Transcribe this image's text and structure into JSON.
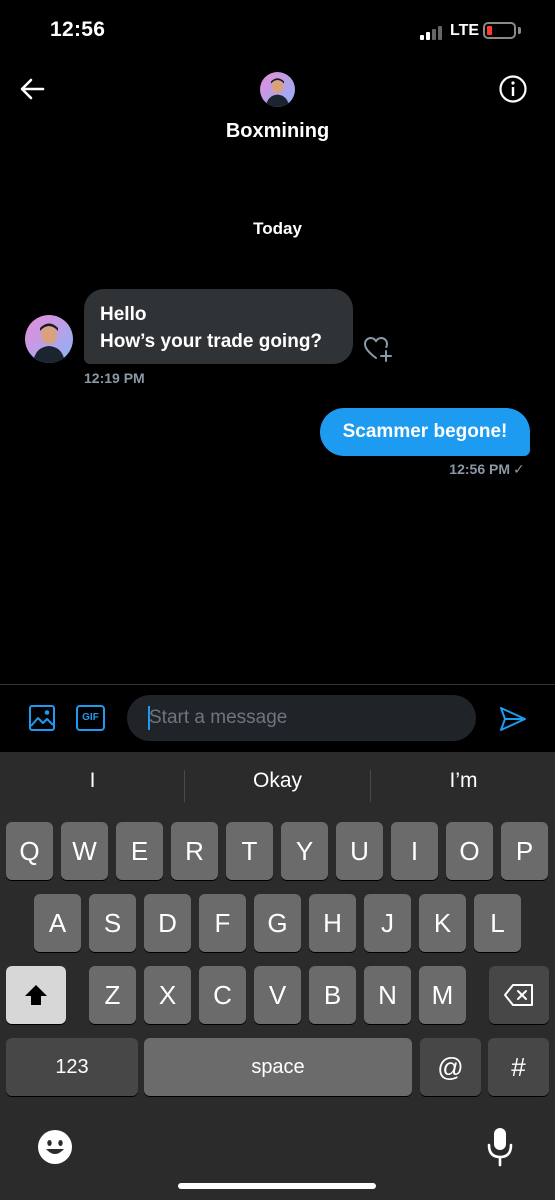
{
  "status_bar": {
    "time": "12:56",
    "network": "LTE"
  },
  "header": {
    "contact_name": "Boxmining"
  },
  "conversation": {
    "day_label": "Today",
    "incoming": {
      "line1": "Hello",
      "line2": "How’s your trade going?",
      "time": "12:19 PM"
    },
    "outgoing": {
      "text": "Scammer begone!",
      "time": "12:56 PM",
      "status": "✓"
    }
  },
  "composer": {
    "placeholder": "Start a message",
    "gif_label": "GIF"
  },
  "keyboard": {
    "suggestions": [
      "I",
      "Okay",
      "I’m"
    ],
    "row1": [
      "Q",
      "W",
      "E",
      "R",
      "T",
      "Y",
      "U",
      "I",
      "O",
      "P"
    ],
    "row2": [
      "A",
      "S",
      "D",
      "F",
      "G",
      "H",
      "J",
      "K",
      "L"
    ],
    "row3": [
      "Z",
      "X",
      "C",
      "V",
      "B",
      "N",
      "M"
    ],
    "numbers_label": "123",
    "space_label": "space",
    "at_label": "@",
    "hash_label": "#"
  },
  "colors": {
    "accent": "#1d9bf0",
    "incoming_bubble": "#2f3336",
    "background": "#000000"
  }
}
